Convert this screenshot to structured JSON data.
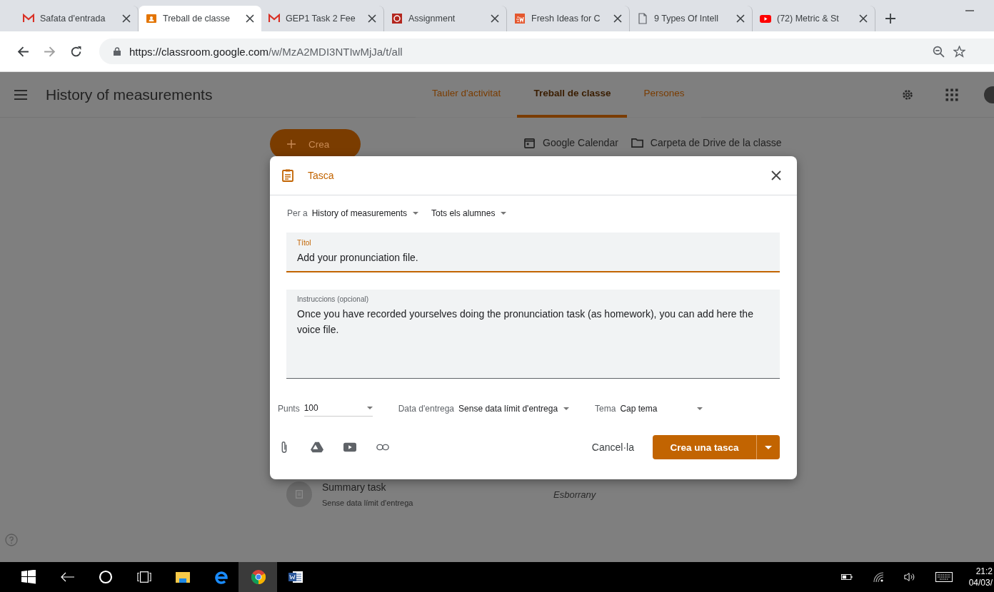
{
  "browser": {
    "tabs": [
      {
        "title": "Safata d'entrada",
        "kind": "mail",
        "selected": false
      },
      {
        "title": "Treball de classe",
        "kind": "classroom",
        "selected": true
      },
      {
        "title": "GEP1 Task 2 Fee",
        "kind": "mail",
        "selected": false
      },
      {
        "title": "Assignment",
        "kind": "document",
        "selected": false
      },
      {
        "title": "Fresh Ideas for C",
        "kind": "logo",
        "selected": false
      },
      {
        "title": "9 Types Of Intell",
        "kind": "page",
        "selected": false
      },
      {
        "title": "(72) Metric & St",
        "kind": "video",
        "selected": false
      }
    ],
    "url_host": "https://classroom.google.com",
    "url_path": "/w/MzA2MDI3NTIwMjJa/t/all"
  },
  "header": {
    "title": "History of measurements",
    "nav": [
      {
        "label": "Tauler d'activitat",
        "selected": false
      },
      {
        "label": "Treball de classe",
        "selected": true
      },
      {
        "label": "Persones",
        "selected": false
      }
    ]
  },
  "page": {
    "create_button": "Crea",
    "links": [
      "Google Calendar",
      "Carpeta de Drive de la classe"
    ],
    "task": {
      "title": "Summary task",
      "due": "Sense data límit d'entrega",
      "status": "Esborrany"
    }
  },
  "dialog": {
    "title": "Tasca",
    "for_label": "Per a",
    "class": "History of measurements",
    "students": "Tots els alumnes",
    "title_field": {
      "label": "Títol",
      "value": "Add your pronunciation file."
    },
    "instructions_field": {
      "label": "Instruccions (opcional)",
      "value": "Once you have recorded yourselves doing the pronunciation task (as homework), you can add here the voice file."
    },
    "points_label": "Punts",
    "points": "100",
    "due_label": "Data d'entrega",
    "due": "Sense data límit d'entrega",
    "topic_label": "Tema",
    "topic": "Cap tema",
    "cancel": "Cancel·la",
    "submit": "Crea una tasca"
  },
  "taskbar": {
    "time": "21:2",
    "date": "04/03/"
  }
}
